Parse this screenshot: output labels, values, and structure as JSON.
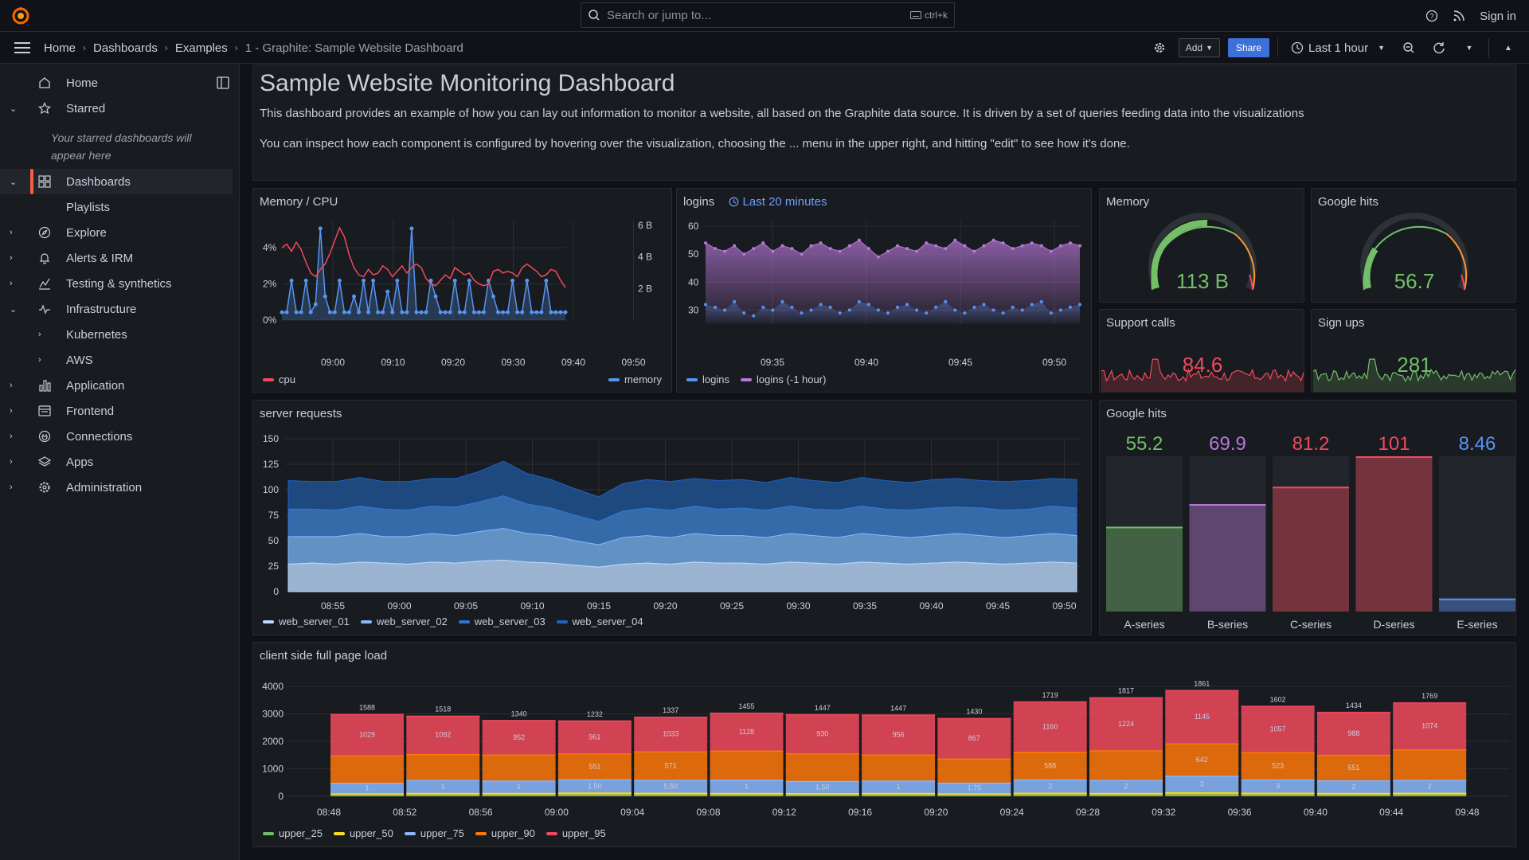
{
  "topbar": {
    "search_placeholder": "Search or jump to...",
    "search_shortcut": "ctrl+k",
    "sign_in": "Sign in"
  },
  "breadcrumbs": [
    "Home",
    "Dashboards",
    "Examples",
    "1 - Graphite: Sample Website Dashboard"
  ],
  "toolbar": {
    "add_label": "Add",
    "share_label": "Share",
    "time_range": "Last 1 hour"
  },
  "sidebar": {
    "items": [
      {
        "label": "Home",
        "icon": "home-icon"
      },
      {
        "label": "Starred",
        "icon": "star-icon"
      },
      {
        "label": "Dashboards",
        "icon": "apps-icon"
      },
      {
        "label": "Playlists"
      },
      {
        "label": "Explore",
        "icon": "compass-icon"
      },
      {
        "label": "Alerts & IRM",
        "icon": "bell-icon"
      },
      {
        "label": "Testing & synthetics",
        "icon": "chart-icon"
      },
      {
        "label": "Infrastructure",
        "icon": "pulse-icon"
      },
      {
        "label": "Kubernetes"
      },
      {
        "label": "AWS"
      },
      {
        "label": "Application",
        "icon": "bars-icon"
      },
      {
        "label": "Frontend",
        "icon": "frontend-icon"
      },
      {
        "label": "Connections",
        "icon": "plug-icon"
      },
      {
        "label": "Apps",
        "icon": "layers-icon"
      },
      {
        "label": "Administration",
        "icon": "cog-icon"
      }
    ],
    "starred_note": "Your starred dashboards will appear here"
  },
  "text_panel": {
    "title": "Sample Website Monitoring Dashboard",
    "p1": "This dashboard provides an example of how you can lay out information to monitor a website, all based on the Graphite data source. It is driven by a set of queries feeding data into the visualizations",
    "p2": "You can inspect how each component is configured by hovering over the visualization, choosing the ... menu in the upper right, and hitting \"edit\" to see how it's done."
  },
  "panels": {
    "memcpu": {
      "title": "Memory / CPU",
      "legend": [
        "cpu",
        "memory"
      ]
    },
    "logins": {
      "title": "logins",
      "time_override": "Last 20 minutes",
      "legend": [
        "logins",
        "logins (-1 hour)"
      ]
    },
    "memory": {
      "title": "Memory",
      "value": "113 B"
    },
    "google_hits_gauge": {
      "title": "Google hits",
      "value": "56.7"
    },
    "support": {
      "title": "Support calls",
      "value": "84.6"
    },
    "signups": {
      "title": "Sign ups",
      "value": "281"
    },
    "server_requests": {
      "title": "server requests",
      "legend": [
        "web_server_01",
        "web_server_02",
        "web_server_03",
        "web_server_04"
      ]
    },
    "google_hits_bars": {
      "title": "Google hits"
    },
    "page_load": {
      "title": "client side full page load",
      "legend": [
        "upper_25",
        "upper_50",
        "upper_75",
        "upper_90",
        "upper_95"
      ]
    }
  },
  "colors": {
    "accent": "#3d71d9",
    "cpu": "#f2495c",
    "memory": "#5794f2",
    "green": "#73bf69",
    "purple": "#b877d9",
    "red": "#f2495c",
    "blue": "#5794f2",
    "orange": "#ff9830",
    "yellow": "#fade2a"
  },
  "chart_data": [
    {
      "type": "line",
      "title": "Memory / CPU",
      "x_ticks": [
        "09:00",
        "09:10",
        "09:20",
        "09:30",
        "09:40",
        "09:50"
      ],
      "y_left_ticks": [
        "0%",
        "2%",
        "4%"
      ],
      "y_right_ticks": [
        "2 B",
        "4 B",
        "6 B"
      ],
      "series": [
        {
          "name": "cpu",
          "unit": "%",
          "values": [
            4.0,
            4.2,
            3.8,
            4.3,
            3.9,
            3.2,
            2.6,
            2.4,
            2.8,
            3.1,
            3.7,
            4.4,
            5.1,
            4.6,
            3.6,
            2.9,
            2.5,
            2.4,
            2.8,
            2.5,
            2.6,
            3.0,
            2.8,
            2.4,
            2.7,
            3.0,
            2.6,
            2.9,
            3.1,
            2.9,
            2.3,
            2.0,
            1.9,
            2.2,
            2.5,
            2.3,
            2.9,
            2.7,
            2.5,
            2.6,
            2.2,
            2.0,
            1.9,
            2.0,
            2.7,
            2.8,
            2.6,
            2.7,
            2.6,
            2.4,
            2.9,
            3.1,
            2.9,
            2.7,
            2.4,
            2.5,
            2.8,
            2.7,
            2.2,
            1.8
          ]
        },
        {
          "name": "memory",
          "unit": "B",
          "values": [
            0.5,
            0.5,
            2.5,
            0.5,
            0.5,
            2.5,
            0.5,
            1.0,
            5.8,
            1.5,
            0.5,
            0.5,
            2.5,
            0.5,
            0.5,
            1.5,
            0.5,
            2.5,
            0.5,
            2.5,
            0.5,
            0.5,
            1.8,
            0.5,
            2.5,
            0.5,
            0.5,
            5.8,
            0.5,
            0.5,
            0.5,
            2.5,
            1.5,
            0.5,
            0.5,
            0.5,
            2.5,
            0.5,
            0.5,
            2.5,
            0.5,
            0.5,
            0.5,
            2.5,
            1.5,
            0.5,
            0.5,
            0.5,
            2.5,
            0.5,
            0.5,
            2.5,
            0.5,
            0.5,
            0.5,
            2.5,
            0.5,
            0.5,
            0.5,
            0.5
          ]
        }
      ]
    },
    {
      "type": "area",
      "title": "logins",
      "x_ticks": [
        "09:35",
        "09:40",
        "09:45",
        "09:50"
      ],
      "y_ticks": [
        30,
        40,
        50,
        60
      ],
      "ylim": [
        25,
        62
      ],
      "series": [
        {
          "name": "logins",
          "values": [
            32,
            31,
            30,
            33,
            29,
            28,
            31,
            30,
            33,
            31,
            29,
            30,
            32,
            31,
            29,
            30,
            33,
            32,
            30,
            29,
            31,
            32,
            30,
            29,
            31,
            33,
            30,
            29,
            31,
            32,
            30,
            29,
            31,
            30,
            32,
            33,
            29,
            30,
            31,
            32
          ]
        },
        {
          "name": "logins (-1 hour)",
          "values": [
            54,
            52,
            51,
            53,
            50,
            52,
            54,
            51,
            53,
            52,
            50,
            53,
            54,
            52,
            51,
            53,
            55,
            52,
            49,
            51,
            53,
            52,
            51,
            54,
            53,
            52,
            55,
            53,
            51,
            53,
            55,
            54,
            52,
            53,
            54,
            53,
            51,
            53,
            54,
            53
          ]
        }
      ]
    },
    {
      "type": "area",
      "title": "server requests",
      "x_ticks": [
        "08:55",
        "09:00",
        "09:05",
        "09:10",
        "09:15",
        "09:20",
        "09:25",
        "09:30",
        "09:35",
        "09:40",
        "09:45",
        "09:50"
      ],
      "y_ticks": [
        0,
        25,
        50,
        75,
        100,
        125,
        150
      ],
      "ylim": [
        0,
        150
      ],
      "stacked": true,
      "series": [
        {
          "name": "web_server_01",
          "values": [
            27,
            28,
            27,
            29,
            28,
            27,
            29,
            28,
            30,
            31,
            29,
            28,
            26,
            24,
            27,
            28,
            27,
            29,
            28,
            28,
            27,
            29,
            28,
            27,
            29,
            28,
            27,
            28,
            29,
            28,
            27,
            28,
            29,
            28
          ]
        },
        {
          "name": "web_server_02",
          "values": [
            27,
            26,
            27,
            28,
            26,
            27,
            28,
            27,
            29,
            31,
            28,
            27,
            24,
            22,
            26,
            27,
            26,
            28,
            27,
            27,
            26,
            28,
            27,
            26,
            28,
            27,
            26,
            27,
            28,
            27,
            26,
            27,
            28,
            27
          ]
        },
        {
          "name": "web_server_03",
          "values": [
            27,
            27,
            26,
            27,
            27,
            26,
            27,
            28,
            29,
            32,
            29,
            27,
            25,
            23,
            26,
            27,
            27,
            27,
            26,
            27,
            27,
            27,
            26,
            27,
            27,
            26,
            27,
            27,
            26,
            27,
            27,
            26,
            27,
            27
          ]
        },
        {
          "name": "web_server_04",
          "values": [
            28,
            27,
            28,
            28,
            27,
            28,
            27,
            28,
            30,
            34,
            30,
            28,
            26,
            24,
            27,
            28,
            28,
            27,
            28,
            28,
            27,
            28,
            28,
            27,
            28,
            28,
            27,
            28,
            28,
            27,
            28,
            28,
            27,
            28
          ]
        }
      ]
    },
    {
      "type": "bar",
      "title": "Google hits",
      "categories": [
        "A-series",
        "B-series",
        "C-series",
        "D-series",
        "E-series"
      ],
      "values": [
        55.2,
        69.9,
        81.2,
        101,
        8.46
      ],
      "labels": [
        "55.2",
        "69.9",
        "81.2",
        "101",
        "8.46"
      ],
      "colors": [
        "#73bf69",
        "#b877d9",
        "#f2495c",
        "#f2495c",
        "#5794f2"
      ],
      "ylim": [
        0,
        101
      ]
    },
    {
      "type": "bar",
      "title": "client side full page load",
      "stacked": true,
      "x_ticks": [
        "08:48",
        "08:52",
        "08:56",
        "09:00",
        "09:04",
        "09:08",
        "09:12",
        "09:16",
        "09:20",
        "09:24",
        "09:28",
        "09:32",
        "09:36",
        "09:40",
        "09:44",
        "09:48"
      ],
      "y_ticks": [
        0,
        1000,
        2000,
        3000,
        4000
      ],
      "ylim": [
        0,
        4000
      ],
      "totals": [
        1588,
        1518,
        1340,
        1232,
        1337,
        1455,
        1447,
        1447,
        1430,
        1719,
        1817,
        1861,
        1602,
        1434,
        1769
      ],
      "upper_95_labels": [
        1029,
        1092,
        952,
        961,
        1033,
        1128,
        930,
        956,
        867,
        1160,
        1224,
        1145,
        1057,
        988,
        1074
      ],
      "upper_90_labels": [
        "",
        "",
        "",
        "551",
        "571",
        "",
        "",
        "",
        "",
        "588",
        "",
        "642",
        "523",
        "551",
        ""
      ],
      "upper_75_labels": [
        "1",
        "1",
        "1",
        "1.50",
        "5.50",
        "1",
        "1.50",
        "1",
        "1.75",
        "2",
        "2",
        "3",
        "3",
        "2",
        "2"
      ],
      "series": [
        {
          "name": "upper_25",
          "values": [
            50,
            55,
            55,
            60,
            55,
            55,
            55,
            55,
            50,
            60,
            55,
            65,
            60,
            55,
            55
          ]
        },
        {
          "name": "upper_50",
          "values": [
            60,
            70,
            70,
            80,
            75,
            70,
            65,
            70,
            60,
            75,
            70,
            85,
            75,
            70,
            75
          ]
        },
        {
          "name": "upper_75",
          "values": [
            380,
            470,
            450,
            480,
            470,
            480,
            440,
            450,
            390,
            480,
            470,
            600,
            480,
            460,
            470
          ]
        },
        {
          "name": "upper_90",
          "values": [
            1010,
            950,
            950,
            940,
            1040,
            1060,
            1010,
            950,
            880,
            1010,
            1080,
            1180,
            1000,
            930,
            1110
          ]
        },
        {
          "name": "upper_95",
          "values": [
            1500,
            1390,
            1250,
            1200,
            1260,
            1380,
            1420,
            1450,
            1470,
            1830,
            1930,
            1940,
            1680,
            1560,
            1710
          ]
        }
      ]
    }
  ]
}
